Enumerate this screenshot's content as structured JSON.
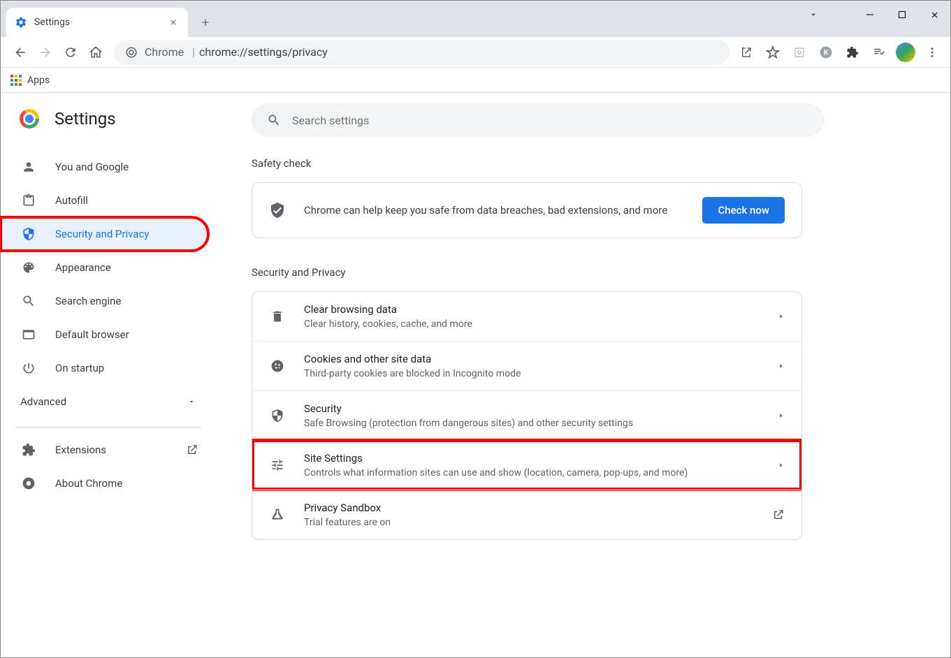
{
  "tab": {
    "title": "Settings"
  },
  "omnibox": {
    "prefix": "Chrome",
    "url": "chrome://settings/privacy"
  },
  "bookmarks": {
    "apps": "Apps"
  },
  "header": {
    "title": "Settings"
  },
  "search": {
    "placeholder": "Search settings"
  },
  "sidebar": {
    "items": [
      {
        "label": "You and Google"
      },
      {
        "label": "Autofill"
      },
      {
        "label": "Security and Privacy"
      },
      {
        "label": "Appearance"
      },
      {
        "label": "Search engine"
      },
      {
        "label": "Default browser"
      },
      {
        "label": "On startup"
      }
    ],
    "advanced": "Advanced",
    "extensions": "Extensions",
    "about": "About Chrome"
  },
  "sections": {
    "safety": {
      "title": "Safety check",
      "text": "Chrome can help keep you safe from data breaches, bad extensions, and more",
      "button": "Check now"
    },
    "privacy": {
      "title": "Security and Privacy",
      "rows": [
        {
          "title": "Clear browsing data",
          "sub": "Clear history, cookies, cache, and more"
        },
        {
          "title": "Cookies and other site data",
          "sub": "Third-party cookies are blocked in Incognito mode"
        },
        {
          "title": "Security",
          "sub": "Safe Browsing (protection from dangerous sites) and other security settings"
        },
        {
          "title": "Site Settings",
          "sub": "Controls what information sites can use and show (location, camera, pop-ups, and more)"
        },
        {
          "title": "Privacy Sandbox",
          "sub": "Trial features are on"
        }
      ]
    }
  }
}
